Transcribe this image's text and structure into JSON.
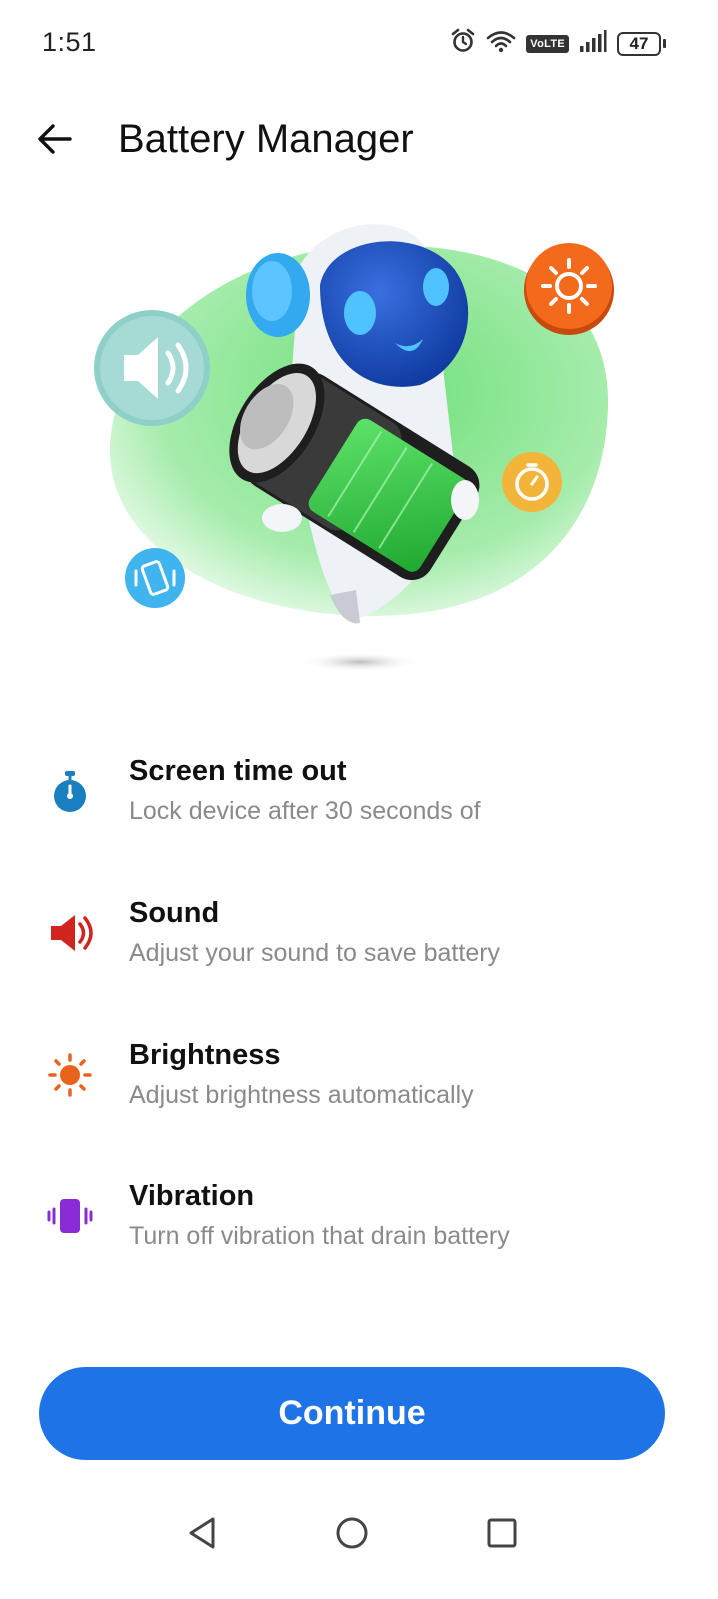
{
  "status_bar": {
    "time": "1:51",
    "network_badge": "VoLTE",
    "battery_level": "47",
    "icons": [
      "alarm-icon",
      "wifi-icon",
      "volte-icon",
      "signal-icon",
      "battery-icon"
    ]
  },
  "app_bar": {
    "back_icon": "arrow-left-icon",
    "title": "Battery Manager"
  },
  "hero": {
    "description_icons": [
      "sound-bubble-icon",
      "brightness-bubble-icon",
      "timer-bubble-icon",
      "vibration-bubble-icon",
      "robot-battery-illustration"
    ]
  },
  "features": [
    {
      "icon": "timer-icon",
      "title": "Screen time out",
      "description": "Lock device after 30 seconds of",
      "icon_color": "#1a7fc1"
    },
    {
      "icon": "speaker-icon",
      "title": "Sound",
      "description": "Adjust your sound to save battery",
      "icon_color": "#d0251e"
    },
    {
      "icon": "sun-icon",
      "title": "Brightness",
      "description": "Adjust brightness automatically",
      "icon_color": "#e8641c"
    },
    {
      "icon": "vibration-icon",
      "title": "Vibration",
      "description": "Turn off vibration that drain battery",
      "icon_color": "#8a2bd8"
    }
  ],
  "continue_label": "Continue",
  "colors": {
    "accent": "#1e74e6",
    "hero_green": "#6fe07a"
  },
  "nav_bar": {
    "icons": [
      "back-triangle-icon",
      "home-circle-icon",
      "recents-square-icon"
    ]
  }
}
